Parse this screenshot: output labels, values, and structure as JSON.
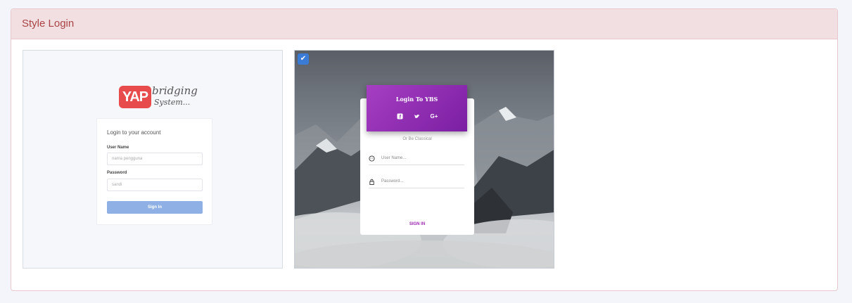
{
  "panel": {
    "title": "Style Login"
  },
  "style1": {
    "logo": {
      "yap": "YAP",
      "line1": "bridging",
      "line2": "System..."
    },
    "form": {
      "title": "Login to your account",
      "username_label": "User Name",
      "username_placeholder": "nama pengguna",
      "password_label": "Password",
      "password_placeholder": "sandi",
      "button": "Sign In"
    }
  },
  "style2": {
    "selected": true,
    "form": {
      "title": "Login To YBS",
      "social": [
        "facebook-icon",
        "twitter-icon",
        "google-plus-icon"
      ],
      "or_text": "Or Be Classical",
      "username_placeholder": "User Name...",
      "password_placeholder": "Password...",
      "button": "SIGN IN"
    }
  },
  "colors": {
    "accent_purple": "#9c27b0",
    "accent_blue": "#3a7bd5",
    "panel_heading": "#f2dfe1",
    "panel_title": "#a94446"
  }
}
